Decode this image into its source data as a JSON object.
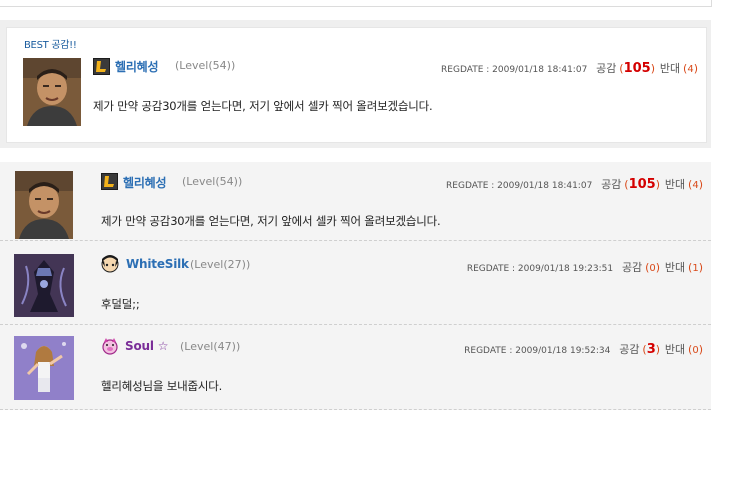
{
  "best": {
    "label": "BEST 공감!!",
    "nick": "헬리혜성",
    "level_word": "Level",
    "level_num": "(54)",
    "regdate_label": "REGDATE : ",
    "regdate": "2009/01/18 18:41:07",
    "agree_label": "공감",
    "agree": "105",
    "disagree_label": "반대",
    "disagree": "4",
    "content": "제가 만약 공감30개를 얻는다면, 저기 앞에서 셀카 찍어 올려보겠습니다."
  },
  "comments": [
    {
      "nick": "헬리혜성",
      "level_word": "Level",
      "level_num": "(54)",
      "regdate_label": "REGDATE : ",
      "regdate": "2009/01/18 18:41:07",
      "agree_label": "공감",
      "agree": "105",
      "disagree_label": "반대",
      "disagree": "4",
      "content": "제가 만약 공감30개를 얻는다면, 저기 앞에서 셀카 찍어 올려보겠습니다."
    },
    {
      "nick": "WhiteSilk",
      "level_word": "Level",
      "level_num": "(27)",
      "regdate_label": "REGDATE : ",
      "regdate": "2009/01/18 19:23:51",
      "agree_label": "공감",
      "agree": "0",
      "disagree_label": "반대",
      "disagree": "1",
      "content": "후덜덜;;"
    },
    {
      "nick": "Soul ☆",
      "level_word": "Level",
      "level_num": "(47)",
      "regdate_label": "REGDATE : ",
      "regdate": "2009/01/18 19:52:34",
      "agree_label": "공감",
      "agree": "3",
      "disagree_label": "반대",
      "disagree": "0",
      "content": "헬리혜성님을 보내줍시다."
    }
  ],
  "colors": {
    "nick_blue": "#2c6fb4",
    "nick_purple": "#7a2d98",
    "agree_red": "#d40000",
    "count_orange": "#d94a1a"
  }
}
